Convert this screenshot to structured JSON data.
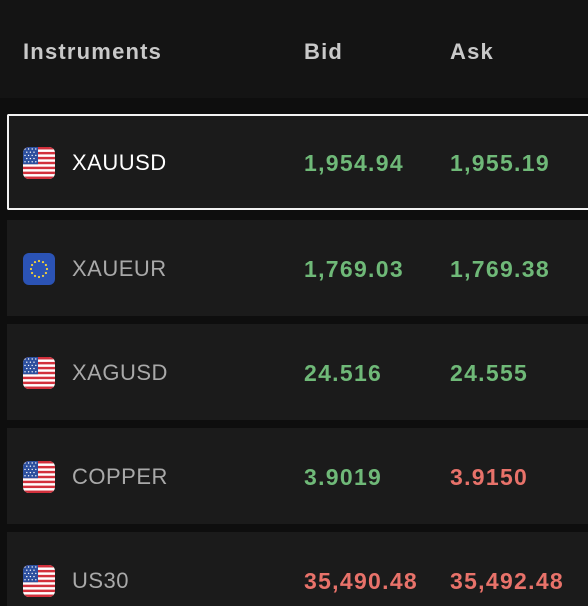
{
  "header": {
    "instruments": "Instruments",
    "bid": "Bid",
    "ask": "Ask"
  },
  "colors": {
    "up": "#6fb978",
    "down": "#e8726a",
    "selected_border": "#f2f2f2"
  },
  "rows": [
    {
      "symbol": "XAUUSD",
      "flag": "us-flag-icon",
      "bid": "1,954.94",
      "ask": "1,955.19",
      "bid_dir": "up",
      "ask_dir": "up",
      "selected": true
    },
    {
      "symbol": "XAUEUR",
      "flag": "eu-flag-icon",
      "bid": "1,769.03",
      "ask": "1,769.38",
      "bid_dir": "up",
      "ask_dir": "up",
      "selected": false
    },
    {
      "symbol": "XAGUSD",
      "flag": "us-flag-icon",
      "bid": "24.516",
      "ask": "24.555",
      "bid_dir": "up",
      "ask_dir": "up",
      "selected": false
    },
    {
      "symbol": "COPPER",
      "flag": "us-flag-icon",
      "bid": "3.9019",
      "ask": "3.9150",
      "bid_dir": "up",
      "ask_dir": "down",
      "selected": false
    },
    {
      "symbol": "US30",
      "flag": "us-flag-icon",
      "bid": "35,490.48",
      "ask": "35,492.48",
      "bid_dir": "down",
      "ask_dir": "down",
      "selected": false
    }
  ]
}
